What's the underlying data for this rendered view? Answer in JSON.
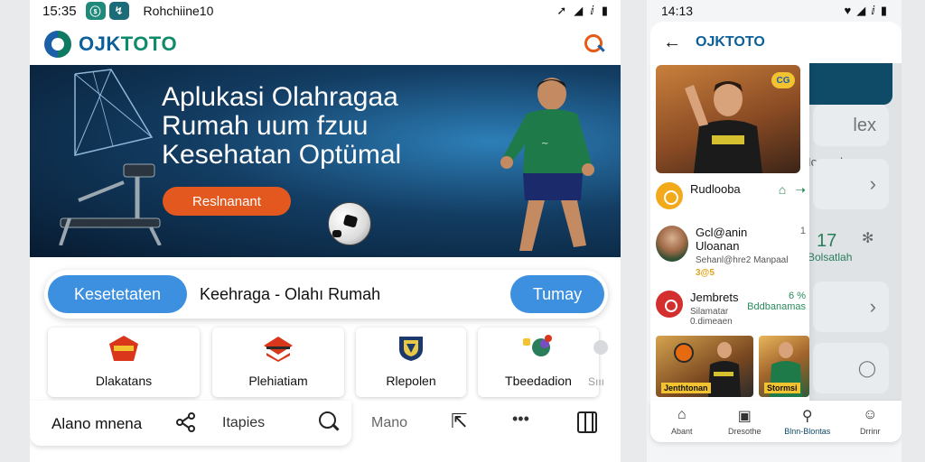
{
  "left_screen": {
    "status_bar": {
      "time": "15:35",
      "carrier": "Rohchiine10"
    },
    "header": {
      "brand_prefix": "OJK",
      "brand_suffix": "TOTO"
    },
    "hero": {
      "title_lines": [
        "Aplukasi Olahragaa",
        "Rumah uum fzuu",
        "Kesehatan Optümal"
      ],
      "cta_label": "Reslnanant"
    },
    "search_bar": {
      "left_pill": "Kesetetaten",
      "query": "Keehraga - Olahı Rumah",
      "right_pill": "Tumay"
    },
    "categories": [
      {
        "label": "Dlakatans",
        "icon": "shield-badge-icon"
      },
      {
        "label": "Plehiatiam",
        "icon": "stack-badge-icon"
      },
      {
        "label": "Rlepolen",
        "icon": "shield-crest-icon"
      },
      {
        "label": "Tbeedadion",
        "icon": "puzzle-icon"
      },
      {
        "label": "Sııı",
        "icon": "faded-icon"
      }
    ],
    "bottom_bar": {
      "label_1": "Alano mnena",
      "label_2": "Itapies",
      "label_3": "Mano"
    }
  },
  "right_screen": {
    "status_bar": {
      "time": "14:13"
    },
    "header": {
      "title": "OJKTOTO"
    },
    "feature_badge": "CG",
    "list": [
      {
        "title": "Rudlooba",
        "sub": "",
        "accent": "",
        "right": ""
      },
      {
        "title": "Gcl@anin",
        "sub": "Uloanan",
        "sub2": "Sehanl@hre2 Manpaal",
        "accent": "3@5",
        "right": "1"
      },
      {
        "title": "Jembrets",
        "sub": "Silamatar 0.dimeaen",
        "accent": "",
        "right": "6 %",
        "right2": "Bddbanamas"
      }
    ],
    "thumbnails": [
      {
        "label": "Jenthtonan"
      },
      {
        "label": "Stormsi"
      }
    ],
    "background": {
      "card_a": "lex",
      "label_1": "Iozeaden",
      "stat": "17",
      "stat_sub": "Bolsatlah",
      "thumb_label": "Blnn-Blontas"
    },
    "bottom_nav": [
      {
        "label": "Abant",
        "icon": "home-icon"
      },
      {
        "label": "Dresothe",
        "icon": "badge-icon"
      },
      {
        "label": "Blnn-Blontas",
        "icon": "search-icon"
      },
      {
        "label": "Drrinr",
        "icon": "profile-icon"
      }
    ]
  },
  "colors": {
    "brand_blue": "#0b5f9a",
    "brand_green": "#0f8a6b",
    "cta_orange": "#e2581f",
    "pill_blue": "#3d8fe0"
  }
}
